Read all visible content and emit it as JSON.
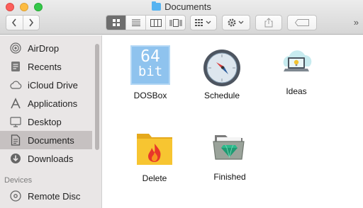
{
  "window": {
    "title": "Documents"
  },
  "toolbar": {
    "back_icon": "chevron-left-icon",
    "forward_icon": "chevron-right-icon",
    "view_modes": [
      "icon-view-icon",
      "list-view-icon",
      "column-view-icon",
      "cover-flow-icon"
    ],
    "active_view": "icon-view-icon",
    "group_icon": "grid-dropdown-icon",
    "action_icon": "gear-icon",
    "share_icon": "share-icon",
    "tag_icon": "tag-icon",
    "overflow_label": "»"
  },
  "sidebar": {
    "favorites": [
      {
        "label": "AirDrop",
        "icon": "airdrop-icon"
      },
      {
        "label": "Recents",
        "icon": "recents-icon"
      },
      {
        "label": "iCloud Drive",
        "icon": "cloud-icon"
      },
      {
        "label": "Applications",
        "icon": "applications-icon"
      },
      {
        "label": "Desktop",
        "icon": "desktop-icon"
      },
      {
        "label": "Documents",
        "icon": "document-icon",
        "selected": true
      },
      {
        "label": "Downloads",
        "icon": "download-icon"
      }
    ],
    "devices_header": "Devices",
    "devices": [
      {
        "label": "Remote Disc",
        "icon": "disc-icon"
      }
    ]
  },
  "files": [
    {
      "name": "DOSBox",
      "icon": "64bit-icon",
      "badge_top": "64",
      "badge_bottom": "bit"
    },
    {
      "name": "Schedule",
      "icon": "compass-icon"
    },
    {
      "name": "Ideas",
      "icon": "idea-laptop-icon"
    },
    {
      "name": "Delete",
      "icon": "fire-folder-icon"
    },
    {
      "name": "Finished",
      "icon": "gem-folder-icon"
    }
  ],
  "colors": {
    "sidebar_bg": "#e9e6e6",
    "sidebar_selected": "#c6c1c1",
    "folder_blue": "#56b3f1",
    "folder_yellow": "#f7c531",
    "badge_blue": "#8fc3ee"
  }
}
